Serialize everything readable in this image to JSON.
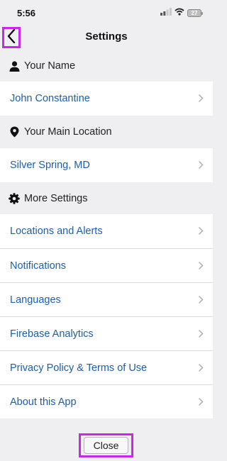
{
  "status_bar": {
    "time": "5:56",
    "battery": "27"
  },
  "nav": {
    "title": "Settings"
  },
  "sections": {
    "name_header": "Your Name",
    "name_value": "John Constantine",
    "location_header": "Your Main Location",
    "location_value": "Silver Spring, MD",
    "more_header": "More Settings",
    "more_items": [
      "Locations and Alerts",
      "Notifications",
      "Languages",
      "Firebase Analytics",
      "Privacy Policy & Terms of Use",
      "About this App"
    ]
  },
  "footer": {
    "close_label": "Close"
  },
  "colors": {
    "accent_link": "#1d5ea8",
    "highlight_border": "#c828e8",
    "background": "#efeff1"
  }
}
